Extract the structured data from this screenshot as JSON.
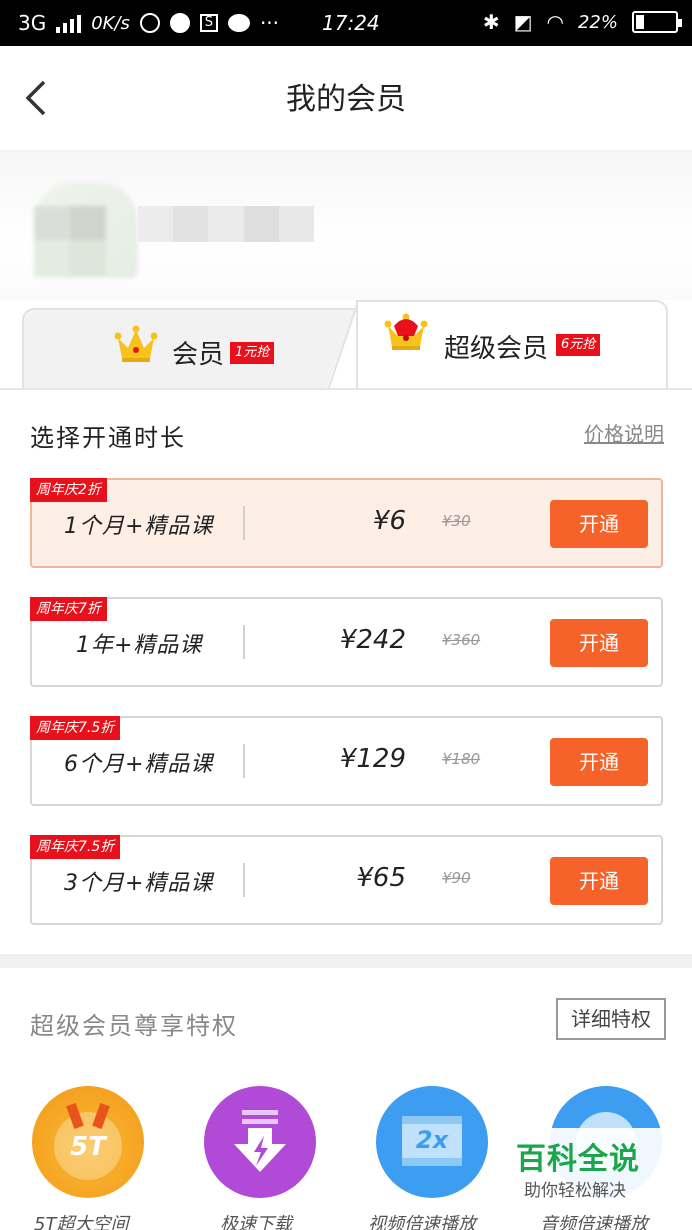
{
  "status_bar": {
    "network": "3G",
    "speed": "0K/s",
    "time": "17:24",
    "battery": "22%",
    "battery_level": 0.22
  },
  "header": {
    "title": "我的会员"
  },
  "tabs": [
    {
      "label": "会员",
      "badge": "1元抢"
    },
    {
      "label": "超级会员",
      "badge": "6元抢"
    }
  ],
  "section": {
    "title": "选择开通时长",
    "price_note": "价格说明"
  },
  "plans": [
    {
      "tag": "周年庆2折",
      "name": "1个月+精品课",
      "price": "¥6",
      "original": "¥30",
      "button": "开通",
      "selected": true
    },
    {
      "tag": "周年庆7折",
      "name": "1年+精品课",
      "price": "¥242",
      "original": "¥360",
      "button": "开通",
      "selected": false
    },
    {
      "tag": "周年庆7.5折",
      "name": "6个月+精品课",
      "price": "¥129",
      "original": "¥180",
      "button": "开通",
      "selected": false
    },
    {
      "tag": "周年庆7.5折",
      "name": "3个月+精品课",
      "price": "¥65",
      "original": "¥90",
      "button": "开通",
      "selected": false
    }
  ],
  "privileges": {
    "title": "超级会员尊享特权",
    "detail_button": "详细特权",
    "items": [
      {
        "label": "5T超大空间",
        "icon": "5T",
        "icon_name": "storage-5t-icon",
        "color": "#f5a623"
      },
      {
        "label": "极速下载",
        "icon": "",
        "icon_name": "fast-download-icon",
        "color": "#b24ad8"
      },
      {
        "label": "视频倍速播放",
        "icon": "2x",
        "icon_name": "video-speed-icon",
        "color": "#3d9df0"
      },
      {
        "label": "音频倍速播放",
        "icon": "",
        "icon_name": "audio-speed-icon",
        "color": "#3d9df0"
      }
    ]
  },
  "watermark": {
    "title": "百科全说",
    "subtitle": "助你轻松解决"
  },
  "colors": {
    "accent": "#f5632b",
    "tag_red": "#e8111b",
    "selected_bg": "#fdeee6"
  }
}
